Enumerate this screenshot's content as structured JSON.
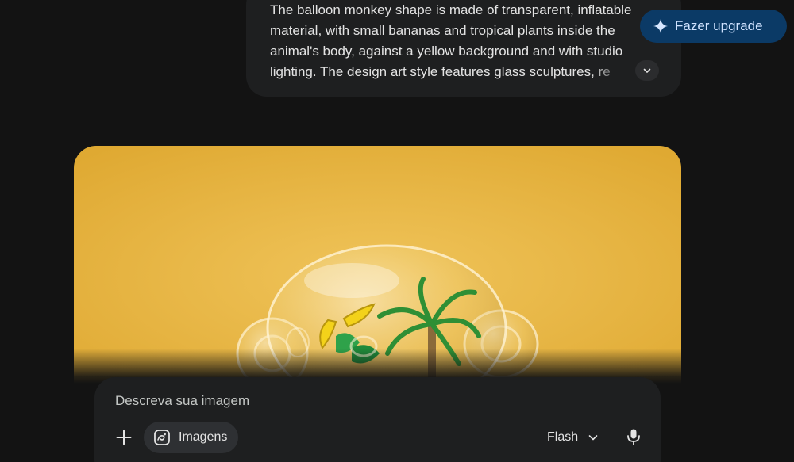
{
  "prompt": {
    "lines": [
      "The balloon monkey shape is made of transparent, inflatable",
      "material, with small bananas and tropical plants inside the",
      "animal's body, against a yellow background and with studio",
      "lighting. The design art style features glass sculptures, re"
    ],
    "expand_icon": "chevron-down-icon"
  },
  "header": {
    "upgrade_label": "Fazer upgrade",
    "upgrade_icon": "sparkle-icon"
  },
  "generated_image": {
    "subject": "glass-monkey-balloon",
    "background_color": "#e8b53e"
  },
  "composer": {
    "placeholder": "Descreva sua imagem",
    "add_icon": "plus-icon",
    "tool_chip_label": "Imagens",
    "tool_chip_icon": "image-tool-icon",
    "model_label": "Flash",
    "model_icon": "chevron-down-icon",
    "mic_icon": "microphone-icon"
  },
  "colors": {
    "background": "#131313",
    "surface": "#1e1f20",
    "upgrade_bg": "#0b3a66",
    "upgrade_text": "#cfe2ff"
  }
}
